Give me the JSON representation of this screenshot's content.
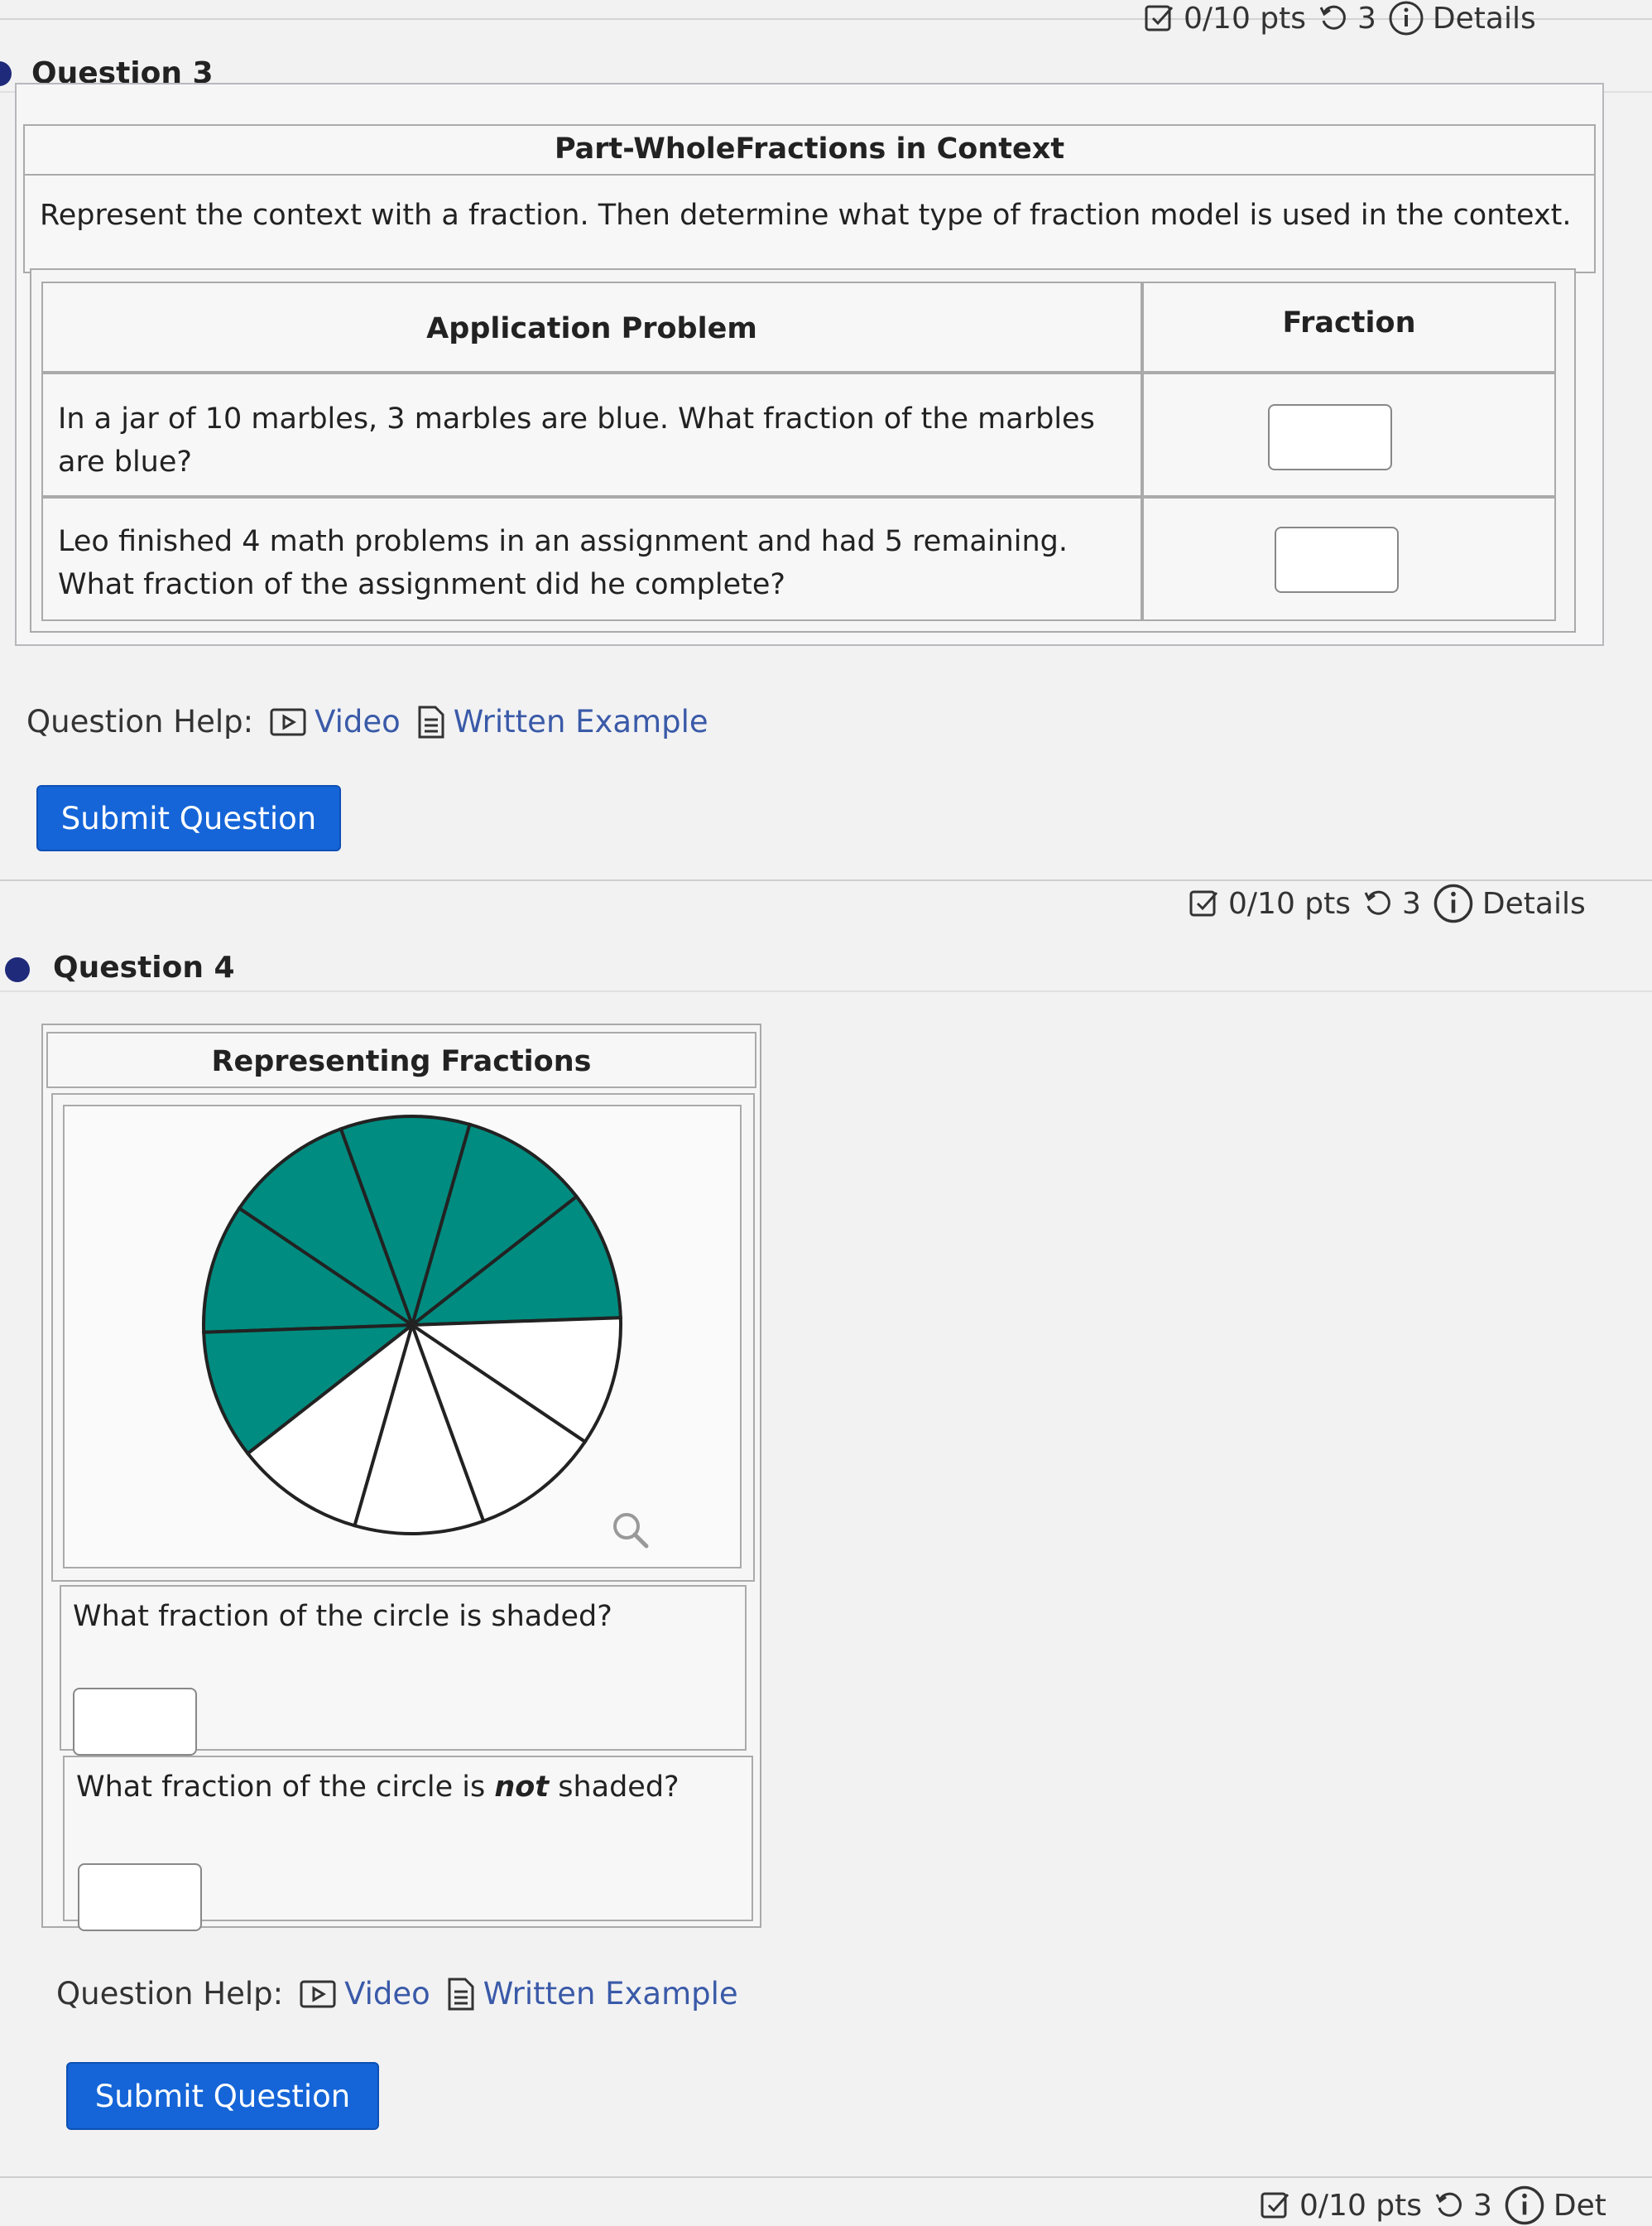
{
  "question3": {
    "title": "Question 3",
    "meta": {
      "points": "0/10 pts",
      "attempts": "3",
      "details": "Details"
    },
    "table_title": "Part-WholeFractions in Context",
    "instructions": "Represent the context with a fraction. Then determine what type of fraction model is used in the context.",
    "columns": [
      "Application Problem",
      "Fraction"
    ],
    "rows": [
      {
        "problem": "In a jar of 10 marbles, 3 marbles are blue. What fraction of the marbles are blue?"
      },
      {
        "problem": "Leo finished 4 math problems in an assignment and had 5 remaining. What fraction of the assignment did he complete?"
      }
    ],
    "help": {
      "label": "Question Help:",
      "video": "Video",
      "written": "Written Example"
    },
    "submit": "Submit Question"
  },
  "question4": {
    "title": "Question 4",
    "meta": {
      "points": "0/10 pts",
      "attempts": "3",
      "details": "Details"
    },
    "table_title": "Representing Fractions",
    "pie": {
      "total_sectors": 10,
      "shaded_sectors": 6,
      "shaded_color": "#008c80",
      "unshaded_color": "#ffffff"
    },
    "prompt_shaded": "What fraction of the circle is shaded?",
    "prompt_not_1": "What fraction of the circle is ",
    "prompt_not_em": "not",
    "prompt_not_2": " shaded?",
    "help": {
      "label": "Question Help:",
      "video": "Video",
      "written": "Written Example"
    },
    "submit": "Submit Question"
  },
  "question5": {
    "meta": {
      "points": "0/10 pts",
      "attempts": "3",
      "details": "Det"
    }
  },
  "colors": {
    "accent": "#1565d8",
    "link": "#3a5aa8",
    "bullet": "#1f2a7a"
  }
}
